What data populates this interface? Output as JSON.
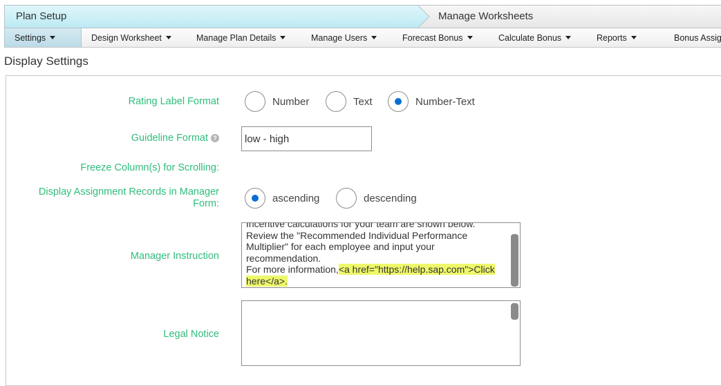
{
  "steps": {
    "active": "Plan Setup",
    "next": "Manage Worksheets"
  },
  "menu": {
    "items": [
      {
        "label": "Settings"
      },
      {
        "label": "Design Worksheet"
      },
      {
        "label": "Manage Plan Details"
      },
      {
        "label": "Manage Users"
      },
      {
        "label": "Forecast Bonus"
      },
      {
        "label": "Calculate Bonus"
      },
      {
        "label": "Reports"
      },
      {
        "label": "Bonus Assig"
      }
    ]
  },
  "section": {
    "title": "Display Settings"
  },
  "form": {
    "rating_label_format": {
      "label": "Rating Label Format",
      "options": [
        "Number",
        "Text",
        "Number-Text"
      ],
      "selected": "Number-Text"
    },
    "guideline_format": {
      "label": "Guideline Format",
      "value": "low - high"
    },
    "freeze_columns": {
      "label": "Freeze Column(s) for Scrolling:"
    },
    "display_assignment": {
      "label": "Display Assignment Records in Manager Form:",
      "options": [
        "ascending",
        "descending"
      ],
      "selected": "ascending"
    },
    "manager_instruction": {
      "label": "Manager Instruction",
      "line1": "Incentive calculations for your team are shown below.",
      "line2": "Review the \"Recommended Individual Performance Multiplier\" for each employee and input your recommendation.",
      "line3_prefix": "For more information,",
      "line3_link": "<a href=\"https://help.sap.com\">Click here</a>."
    },
    "legal_notice": {
      "label": "Legal Notice",
      "value": ""
    }
  },
  "colors": {
    "label_green": "#2fbd7a",
    "radio_blue": "#0a6ed1",
    "highlight": "#eef86a",
    "active_step": "#bdeaf3"
  }
}
